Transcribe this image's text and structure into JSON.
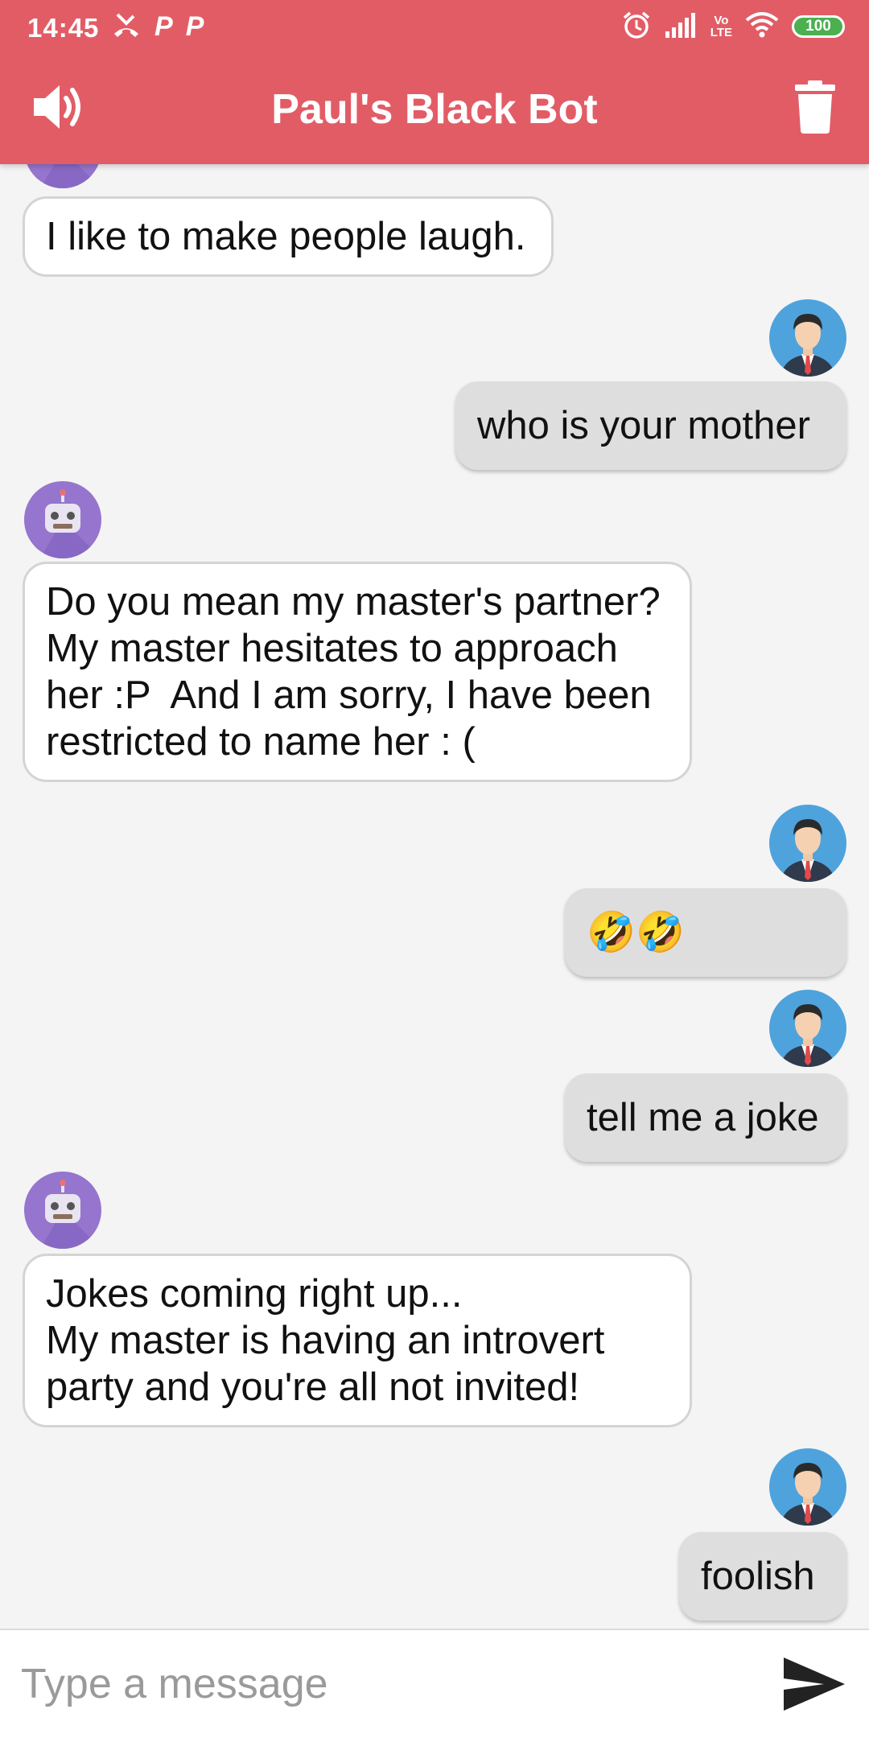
{
  "status_bar": {
    "time": "14:45",
    "notification_icons": [
      "missed-call-icon",
      "p-app-icon",
      "p-app-icon"
    ],
    "right_icons": [
      "alarm-icon",
      "signal-icon",
      "volte-icon",
      "wifi-icon"
    ],
    "volte_top": "Vo",
    "volte_bottom": "LTE",
    "battery": "100"
  },
  "app_bar": {
    "title": "Paul's Black Bot",
    "left_icon": "speaker-icon",
    "right_icon": "trash-icon",
    "color": "#e25c66"
  },
  "messages": [
    {
      "sender": "bot",
      "lines": [
        "I like to make people laugh."
      ]
    },
    {
      "sender": "user",
      "lines": [
        "who is your mother"
      ]
    },
    {
      "sender": "bot",
      "lines": [
        "Do you mean my master's partner?",
        "My master hesitates to approach",
        "her :P  And I am sorry, I have been",
        "restricted to name her : ("
      ]
    },
    {
      "sender": "user",
      "lines": [
        "🤣🤣"
      ]
    },
    {
      "sender": "user",
      "lines": [
        "tell me a joke"
      ]
    },
    {
      "sender": "bot",
      "lines": [
        "Jokes coming right up...",
        "My master is having an introvert",
        "party and you're all not invited!"
      ]
    },
    {
      "sender": "user",
      "lines": [
        "foolish"
      ]
    }
  ],
  "input": {
    "placeholder": "Type a message",
    "value": "",
    "send_icon": "send-icon"
  },
  "colors": {
    "accent": "#e25c66",
    "bot_avatar": "#9575cd",
    "user_avatar": "#4ea3dd",
    "chat_background": "#f4f4f4"
  }
}
